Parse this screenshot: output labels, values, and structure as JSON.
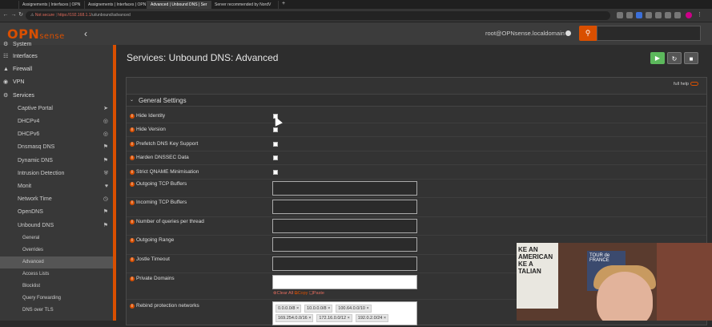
{
  "browser": {
    "tabs": [
      {
        "label": "Assignements | Interfaces | OPN"
      },
      {
        "label": "Assignements | Interfaces | OPN"
      },
      {
        "label": "Advanced | Unbound DNS | Ser"
      },
      {
        "label": "Server recommended by NordV"
      }
    ],
    "new_tab": "+",
    "url_warning": "Not secure",
    "url_host": "https://192.168.1.1",
    "url_path": "/ui/unbound/advanced"
  },
  "header": {
    "logo_main": "OPN",
    "logo_sub": "sense",
    "user": "root@OPNsense.localdomain",
    "search_placeholder": ""
  },
  "sidebar": {
    "items": [
      {
        "label": "System",
        "icon": "gear-icon"
      },
      {
        "label": "Interfaces",
        "icon": "network-icon"
      },
      {
        "label": "Firewall",
        "icon": "fire-icon"
      },
      {
        "label": "VPN",
        "icon": "globe-icon"
      },
      {
        "label": "Services",
        "icon": "cog-icon"
      }
    ],
    "services": [
      {
        "label": "Captive Portal",
        "icon": "plane-icon"
      },
      {
        "label": "DHCPv4",
        "icon": "target-icon"
      },
      {
        "label": "DHCPv6",
        "icon": "target-icon"
      },
      {
        "label": "Dnsmasq DNS",
        "icon": "tags-icon"
      },
      {
        "label": "Dynamic DNS",
        "icon": "tags-icon"
      },
      {
        "label": "Intrusion Detection",
        "icon": "shield-icon"
      },
      {
        "label": "Monit",
        "icon": "heart-icon"
      },
      {
        "label": "Network Time",
        "icon": "clock-icon"
      },
      {
        "label": "OpenDNS",
        "icon": "tags-icon"
      },
      {
        "label": "Unbound DNS",
        "icon": "tags-icon"
      }
    ],
    "unbound": [
      {
        "label": "General"
      },
      {
        "label": "Overrides"
      },
      {
        "label": "Advanced"
      },
      {
        "label": "Access Lists"
      },
      {
        "label": "Blocklist"
      },
      {
        "label": "Query Forwarding"
      },
      {
        "label": "DNS over TLS"
      }
    ]
  },
  "main": {
    "title": "Services: Unbound DNS: Advanced",
    "full_help": "full help",
    "section": "General Settings",
    "checkbox_rows": [
      {
        "label": "Hide Identity",
        "checked": false
      },
      {
        "label": "Hide Version",
        "checked": false
      },
      {
        "label": "Prefetch DNS Key Support",
        "checked": false
      },
      {
        "label": "Harden DNSSEC Data",
        "checked": false
      },
      {
        "label": "Strict QNAME Minimisation",
        "checked": false
      }
    ],
    "text_rows": [
      {
        "label": "Outgoing TCP Buffers",
        "value": ""
      },
      {
        "label": "Incoming TCP Buffers",
        "value": ""
      },
      {
        "label": "Number of queries per thread",
        "value": ""
      },
      {
        "label": "Outgoing Range",
        "value": ""
      },
      {
        "label": "Jostle Timeout",
        "value": ""
      }
    ],
    "private_domains": {
      "label": "Private Domains",
      "value": "",
      "clear": "Clear All",
      "copy": "Copy",
      "paste": "Paste"
    },
    "rebind": {
      "label": "Rebind protection networks",
      "tags": [
        "0.0.0.0/8",
        "10.0.0.0/8",
        "100.64.0.0/10",
        "169.254.0.0/16",
        "172.16.0.0/12",
        "192.0.2.0/24"
      ]
    }
  },
  "webcam": {
    "poster_text": "KE AN AMERICAN KE A TALIAN",
    "poster2_text": "TOUR de FRANCE"
  },
  "colors": {
    "accent": "#d94f00",
    "apply": "#5cb85c"
  }
}
